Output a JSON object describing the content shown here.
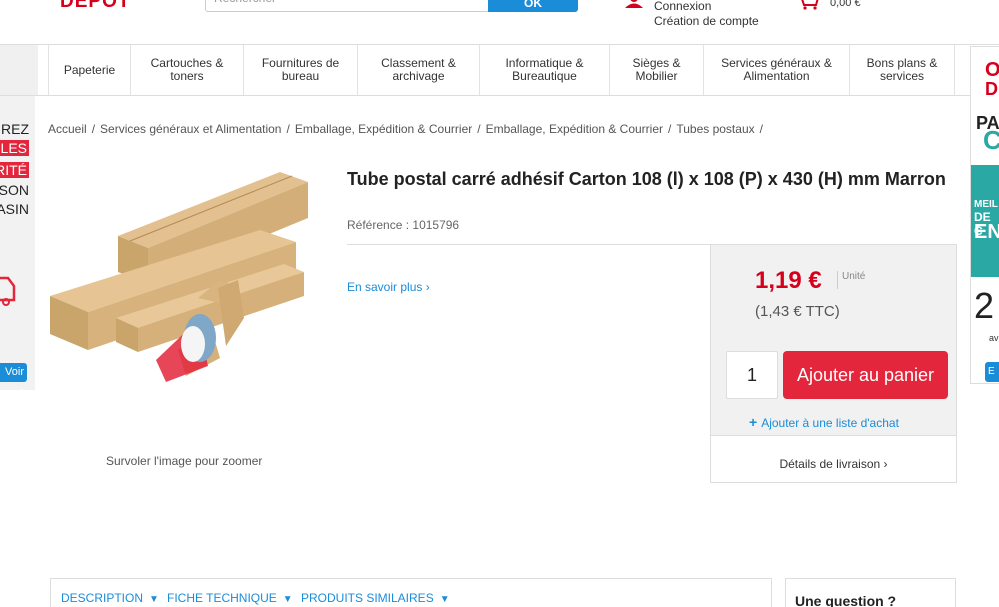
{
  "header": {
    "logo_text": "DEPOT",
    "search_placeholder": "Rechercher",
    "search_button_label": "OK",
    "login_label": "Connexion",
    "create_account_label": "Création de compte",
    "cart_total": "0,00 €",
    "accent_color": "#d6001c",
    "link_color": "#1a8cd8"
  },
  "nav": {
    "items": [
      {
        "label": "Papeterie"
      },
      {
        "label": "Cartouches & toners"
      },
      {
        "label": "Fournitures de bureau"
      },
      {
        "label": "Classement & archivage"
      },
      {
        "label": "Informatique & Bureautique"
      },
      {
        "label": "Sièges & Mobilier"
      },
      {
        "label": "Services généraux & Alimentation"
      },
      {
        "label": "Bons plans & services"
      }
    ]
  },
  "left_ad": {
    "lines": [
      "REZ",
      "LES",
      "RITÉ",
      "SON",
      "ASIN"
    ],
    "button_label": "Voir ›"
  },
  "right_ad": {
    "lines": [
      "O",
      "D",
      "PA",
      "C",
      "MEIL",
      "DE C",
      "EN",
      "2",
      "av"
    ],
    "button_label": "E"
  },
  "breadcrumb": [
    "Accueil",
    "Services généraux et Alimentation",
    "Emballage, Expédition & Courrier",
    "Emballage, Expédition & Courrier",
    "Tubes postaux"
  ],
  "product": {
    "title": "Tube postal carré adhésif Carton 108 (l) x 108 (P) x 430 (H) mm Marron",
    "reference_label": "Référence :",
    "reference": "1015796",
    "learn_more": "En savoir plus ›",
    "zoom_hint": "Survoler l'image pour zoomer",
    "price_ht": "1,19 €",
    "unit_label": "Unité",
    "price_ttc": "(1,43 € TTC)",
    "quantity": "1",
    "add_to_cart": "Ajouter au panier",
    "add_to_list": "Ajouter à une liste d'achat",
    "delivery_details": "Détails de livraison ›"
  },
  "tabs": [
    {
      "label": "DESCRIPTION"
    },
    {
      "label": "FICHE TECHNIQUE"
    },
    {
      "label": "PRODUITS SIMILAIRES"
    }
  ],
  "question_box": {
    "title": "Une question ?"
  }
}
